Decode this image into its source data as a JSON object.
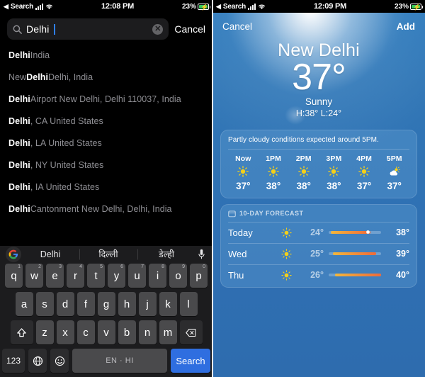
{
  "left_panel": {
    "status_bar": {
      "back_label": "Search",
      "back_glyph": "◀",
      "time": "12:08 PM",
      "battery_percent": "23%",
      "signal_icon": "cellular-bars-icon",
      "wifi_icon": "wifi-icon",
      "battery_icon": "battery-charging-icon"
    },
    "search": {
      "value": "Delhi",
      "placeholder": "Search",
      "search_icon": "search-icon",
      "clear_icon": "clear-circle-icon",
      "clear_glyph": "✕",
      "cancel_label": "Cancel"
    },
    "results": [
      {
        "bold": "Delhi",
        "rest": " India"
      },
      {
        "bold": "New Delhi",
        "rest": " Delhi, India",
        "prefix": "New ",
        "bold_only": "Delhi"
      },
      {
        "bold": "Delhi",
        "rest": " Airport New Delhi, Delhi 110037, India"
      },
      {
        "bold": "Delhi",
        "rest": ", CA United States"
      },
      {
        "bold": "Delhi",
        "rest": ", LA United States"
      },
      {
        "bold": "Delhi",
        "rest": ", NY United States"
      },
      {
        "bold": "Delhi",
        "rest": ", IA United States"
      },
      {
        "bold": "Delhi",
        "rest": " Cantonment New Delhi, Delhi, India"
      }
    ],
    "keyboard": {
      "google_icon": "google-logo-icon",
      "mic_icon": "microphone-icon",
      "suggestions": [
        "Delhi",
        "दिल्ली",
        "डेल्ही"
      ],
      "row1": [
        {
          "k": "q",
          "n": "1"
        },
        {
          "k": "w",
          "n": "2"
        },
        {
          "k": "e",
          "n": "3"
        },
        {
          "k": "r",
          "n": "4"
        },
        {
          "k": "t",
          "n": "5"
        },
        {
          "k": "y",
          "n": "6"
        },
        {
          "k": "u",
          "n": "7"
        },
        {
          "k": "i",
          "n": "8"
        },
        {
          "k": "o",
          "n": "9"
        },
        {
          "k": "p",
          "n": "0"
        }
      ],
      "row2": [
        "a",
        "s",
        "d",
        "f",
        "g",
        "h",
        "j",
        "k",
        "l"
      ],
      "row3": [
        "z",
        "x",
        "c",
        "v",
        "b",
        "n",
        "m"
      ],
      "shift_icon": "shift-up-icon",
      "backspace_icon": "backspace-delete-icon",
      "numbers_label": "123",
      "globe_icon": "globe-language-icon",
      "emoji_icon": "emoji-smiley-icon",
      "space_label": "EN · HI",
      "search_key_label": "Search"
    }
  },
  "right_panel": {
    "status_bar": {
      "back_label": "Search",
      "back_glyph": "◀",
      "time": "12:09 PM",
      "battery_percent": "23%"
    },
    "header": {
      "cancel_label": "Cancel",
      "add_label": "Add"
    },
    "current": {
      "city": "New Delhi",
      "temperature": "37°",
      "condition": "Sunny",
      "high_low": "H:38°  L:24°"
    },
    "hourly": {
      "note": "Partly cloudy conditions expected around 5PM.",
      "entries": [
        {
          "time": "Now",
          "icon": "sun-icon",
          "temp": "37°"
        },
        {
          "time": "1PM",
          "icon": "sun-icon",
          "temp": "38°"
        },
        {
          "time": "2PM",
          "icon": "sun-icon",
          "temp": "38°"
        },
        {
          "time": "3PM",
          "icon": "sun-icon",
          "temp": "38°"
        },
        {
          "time": "4PM",
          "icon": "sun-icon",
          "temp": "37°"
        },
        {
          "time": "5PM",
          "icon": "sun-cloud-icon",
          "temp": "37°"
        }
      ]
    },
    "tenday": {
      "header_label": "10-DAY FORECAST",
      "header_icon": "calendar-icon",
      "rows": [
        {
          "day": "Today",
          "icon": "sun-icon",
          "low": "24°",
          "high": "38°",
          "bar_start": 4,
          "bar_end": 80,
          "dot": 72
        },
        {
          "day": "Wed",
          "icon": "sun-icon",
          "low": "25°",
          "high": "39°",
          "bar_start": 8,
          "bar_end": 90,
          "dot": null
        },
        {
          "day": "Thu",
          "icon": "sun-icon",
          "low": "26°",
          "high": "40°",
          "bar_start": 12,
          "bar_end": 100,
          "dot": null
        }
      ]
    }
  },
  "annotation": {
    "arrow_color": "#e8211b",
    "arrow_target": "add-button"
  },
  "colors": {
    "accent_blue": "#2f6ee0",
    "sky_blue": "#2f72b4",
    "key_gray": "#4a4a4c",
    "battery_green": "#34c759",
    "sun_yellow": "#f5d018"
  }
}
